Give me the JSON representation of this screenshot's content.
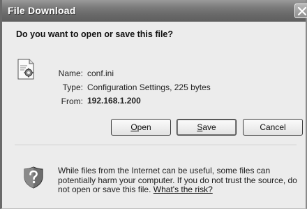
{
  "window": {
    "title": "File Download",
    "close_glyph": "X"
  },
  "question": "Do you want to open or save this file?",
  "file_info": {
    "name_label": "Name:",
    "name_value": "conf.ini",
    "type_label": "Type:",
    "type_value": "Configuration Settings, 225 bytes",
    "from_label": "From:",
    "from_value": "192.168.1.200"
  },
  "buttons": {
    "open": {
      "mnemonic": "O",
      "rest": "pen"
    },
    "save": {
      "mnemonic": "S",
      "rest": "ave"
    },
    "cancel": "Cancel"
  },
  "warning": {
    "text": "While files from the Internet can be useful, some files can potentially harm your computer. If you do not trust the source, do not open or save this file.",
    "link": "What's the risk?"
  },
  "icons": {
    "file": "file-settings-icon",
    "shield": "shield-question-icon",
    "close": "close-icon"
  }
}
